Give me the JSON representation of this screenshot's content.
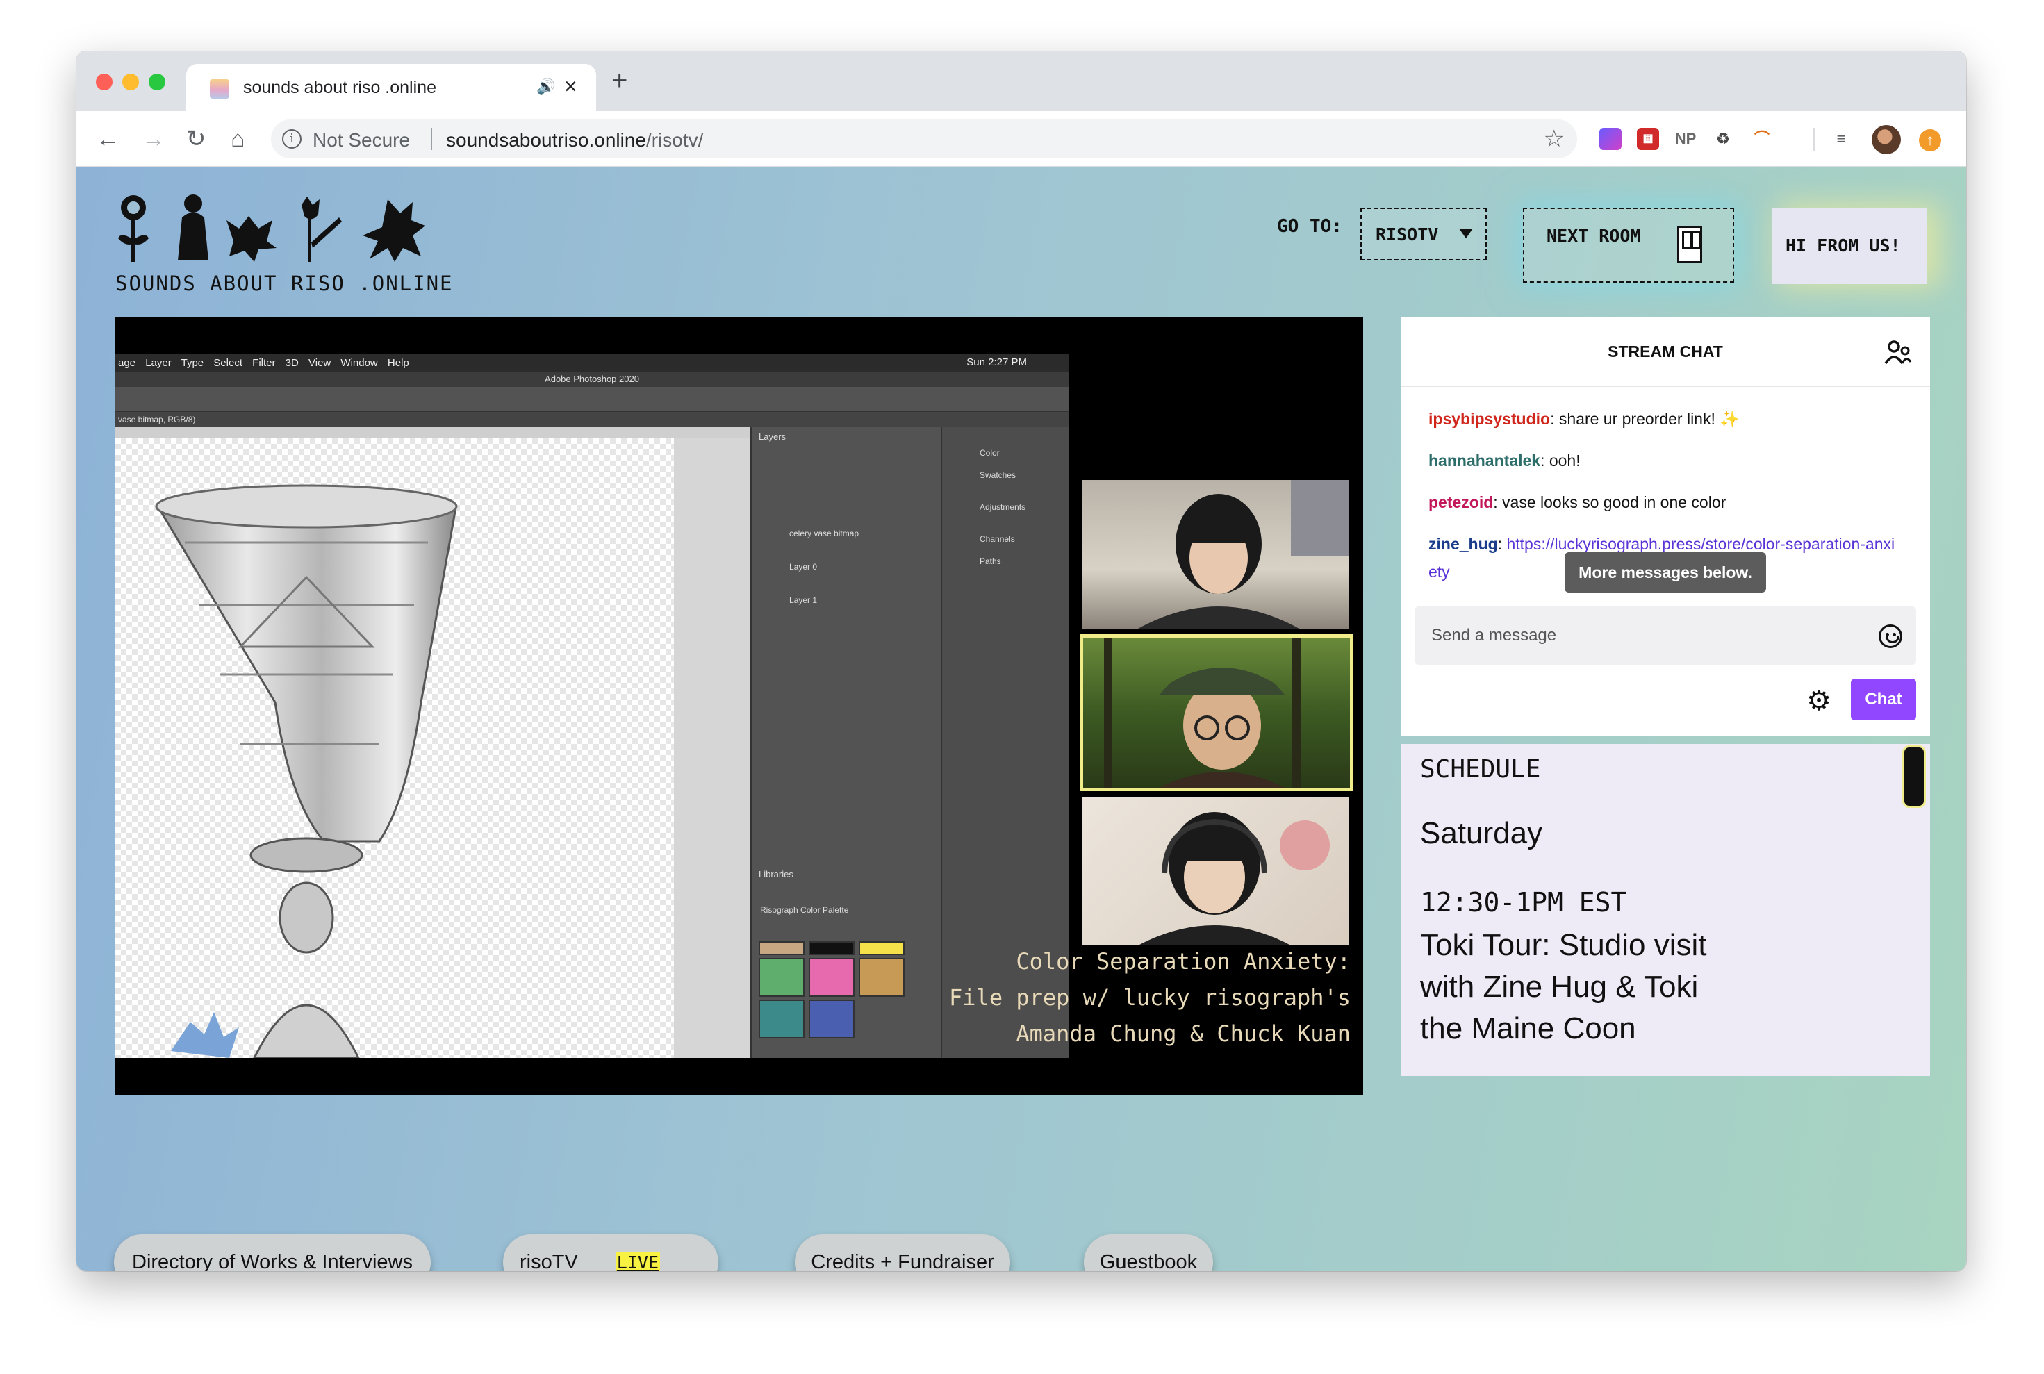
{
  "browser": {
    "tab_title": "sounds about riso .online",
    "new_tab_symbol": "+",
    "security_label": "Not Secure",
    "url_host": "soundsaboutriso.online",
    "url_path": "/risotv/",
    "extensions": [
      "puzzle-ext",
      "red-ext",
      "NP",
      "recycle-ext",
      "rainbow-ext"
    ]
  },
  "site": {
    "name": "SOUNDS ABOUT RISO .ONLINE",
    "goto_label": "GO TO:",
    "room_select_value": "RISOTV",
    "next_room_label": "NEXT ROOM",
    "hi_label": "HI FROM US!"
  },
  "player": {
    "ps_menu": "age Layer Type Select Filter 3D View Window Help",
    "ps_clock": "Sun 2:27 PM",
    "ps_title": "Adobe Photoshop 2020",
    "ps_doc": "vase bitmap, RGB/8)",
    "ps_layers_title": "Layers",
    "ps_libraries_title": "Libraries",
    "ps_palette": "Risograph Color Palette",
    "ps_panels": [
      "Color",
      "Swatches",
      "Adjustments",
      "Channels",
      "Paths"
    ],
    "ps_layer_names": [
      "celery vase bitmap",
      "Layer 0",
      "Layer 1"
    ],
    "swatch_colors": [
      "#c8a882",
      "#111111",
      "#f5e14a",
      "#5fae6e",
      "#e86aae",
      "#c79a55",
      "#3d8a8a",
      "#4a5fb0"
    ],
    "overlay_lines": [
      "Color Separation Anxiety:",
      "File prep w/ lucky risograph's",
      "Amanda Chung & Chuck Kuan"
    ]
  },
  "chat": {
    "title": "STREAM CHAT",
    "messages": [
      {
        "user": "ipsybipsystudio",
        "text": ": share ur preorder link! ✨",
        "color": "#d0261c"
      },
      {
        "user": "hannahantalek",
        "text": ": ooh!",
        "color": "#2e6e6a"
      },
      {
        "user": "petezoid",
        "text": ": vase looks so good in one color",
        "color": "#c2185b"
      },
      {
        "user": "zine_hug",
        "text": ": ",
        "link": "https://luckyrisograph.press/store/color-separation-anxiety",
        "color": "#1a3c8a"
      }
    ],
    "more_messages": "More messages below.",
    "input_placeholder": "Send a message",
    "send_label": "Chat"
  },
  "schedule": {
    "label": "SCHEDULE",
    "day": "Saturday",
    "time": "12:30-1PM EST",
    "event": "Toki Tour: Studio visit with Zine Hug & Toki the Maine Coon"
  },
  "nav": {
    "directory": "Directory of Works & Interviews",
    "risotv": "risoTV",
    "live_badge": "LIVE",
    "credits": "Credits + Fundraiser",
    "guestbook": "Guestbook"
  }
}
